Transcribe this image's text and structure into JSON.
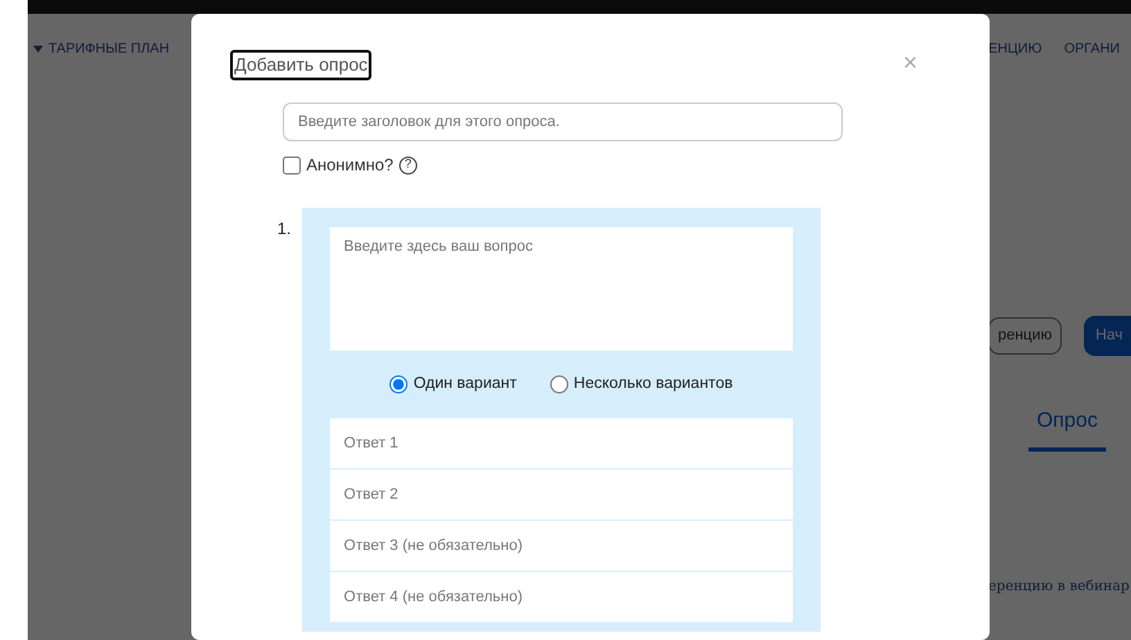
{
  "background": {
    "nav_left": "ТАРИФНЫЕ ПЛАН",
    "nav_right": [
      "ЕНЦИЮ",
      "ОРГАНИ"
    ],
    "buttons": [
      {
        "label": "ренцию",
        "kind": "outline"
      },
      {
        "label": "Нач",
        "kind": "primary"
      }
    ],
    "tab": {
      "label": "Опрос",
      "selected": true
    },
    "link": "еренцию в вебинар"
  },
  "dialog": {
    "title": "Добавить опрос",
    "close": "×",
    "title_field": {
      "placeholder": "Введите заголовок для этого опроса."
    },
    "anonymous": {
      "label": "Анонимно?",
      "checked": false,
      "help": "?"
    },
    "questions": [
      {
        "number": "1.",
        "placeholder": "Введите здесь ваш вопрос",
        "options": [
          {
            "label": "Один вариант",
            "selected": true
          },
          {
            "label": "Несколько вариантов",
            "selected": false
          }
        ],
        "answers": [
          {
            "placeholder": "Ответ 1"
          },
          {
            "placeholder": "Ответ 2"
          },
          {
            "placeholder": "Ответ 3 (не обязательно)"
          },
          {
            "placeholder": "Ответ 4 (не обязательно)"
          }
        ]
      }
    ]
  }
}
